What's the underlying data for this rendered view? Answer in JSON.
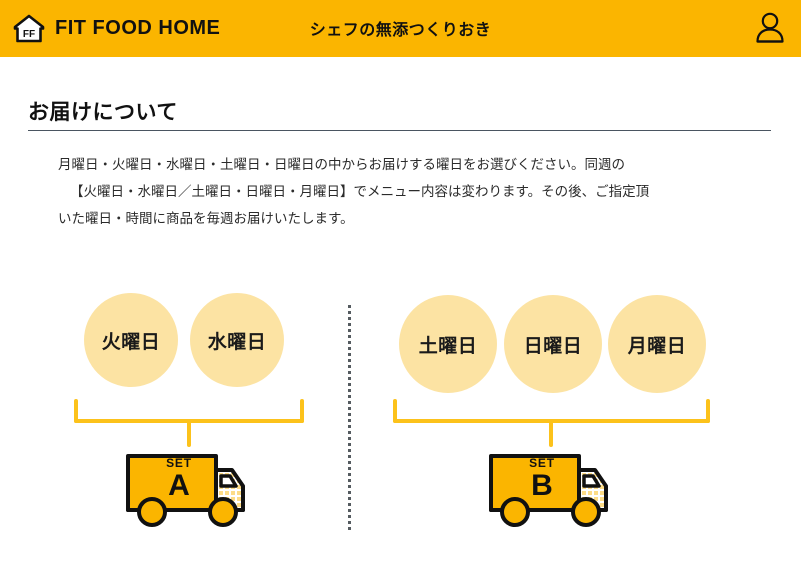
{
  "header": {
    "logo_text": "FF",
    "logo_icon": "house-icon",
    "brand_name": "FIT FOOD HOME",
    "title": "シェフの無添つくりおき",
    "account_icon": "user-icon",
    "background_color": "#fbb500"
  },
  "section": {
    "title": "お届けについて",
    "body_line1": "月曜日・火曜日・水曜日・土曜日・日曜日の中からお届けする曜日をお選びください。同週の",
    "body_line2": "【火曜日・水曜日／土曜日・日曜日・月曜日】でメニュー内容は変わります。その後、ご指定頂",
    "body_line3": "いた曜日・時間に商品を毎週お届けいたします。"
  },
  "diagram": {
    "circle_color": "#fce3a3",
    "bracket_color": "#fcc21b",
    "divider_color": "#555b60",
    "groups": [
      {
        "id": "set-a",
        "days": [
          "火曜日",
          "水曜日"
        ],
        "set_word": "SET",
        "set_letter": "A"
      },
      {
        "id": "set-b",
        "days": [
          "土曜日",
          "日曜日",
          "月曜日"
        ],
        "set_word": "SET",
        "set_letter": "B"
      }
    ]
  }
}
